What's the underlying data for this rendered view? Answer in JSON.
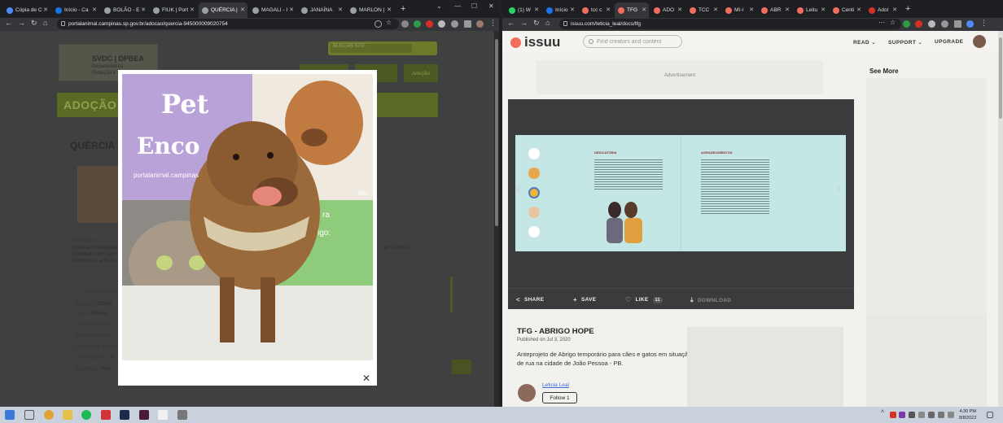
{
  "left_browser": {
    "tabs": [
      {
        "label": "Cópia de C",
        "color": "#4e8df5"
      },
      {
        "label": "Início - Ca",
        "color": "#1a73e8"
      },
      {
        "label": "BOLÃO - E",
        "color": "#9aa0a6"
      },
      {
        "label": "FIUK | Port",
        "color": "#9aa0a6"
      },
      {
        "label": "QUÉRCIA |",
        "color": "#9aa0a6"
      },
      {
        "label": "MAGALI - I",
        "color": "#9aa0a6"
      },
      {
        "label": "JANAÍNA",
        "color": "#9aa0a6"
      },
      {
        "label": "MARLON |",
        "color": "#9aa0a6"
      }
    ],
    "url": "portalanimal.campinas.sp.gov.br/adocao/quercia-945000009020754",
    "page": {
      "logo_text": "SVDC | DPBEA",
      "logo_sub_1": "Departamento",
      "logo_sub_2": "Proteção e",
      "search_placeholder": "BUSCAR SITE",
      "nav_3": "Adoção",
      "banner": "ADOÇÃO",
      "heading": "QUÉRCIA",
      "description_label": "Descrição:",
      "desc_line_1": "Quércia foi resgatada",
      "desc_line_2": "Perueiras tem sido",
      "desc_line_3": "O prazo do adoção",
      "desc_right": "ao DPBEA.",
      "characteristics": "• Características",
      "fields": [
        {
          "label": "Espécie:",
          "value": "Canin"
        },
        {
          "label": "Sexo:",
          "value": "Fêmea"
        },
        {
          "label": "Idade Estimada:",
          "value": ""
        },
        {
          "label": "Porte/Tamanho:",
          "value": ""
        },
        {
          "label": "Estado de Saúde:",
          "value": ""
        },
        {
          "label": "Vermifugado:",
          "value": "S"
        },
        {
          "label": "Castrado:",
          "value": "Não"
        }
      ]
    },
    "modal": {
      "photo_text_1": "Pet",
      "photo_text_2": "Enco",
      "photo_site": "portalanimal.campinas",
      "photo_side_1": "ra",
      "photo_side_2": "igo:",
      "photo_corner": "Mo"
    }
  },
  "right_browser": {
    "tabs": [
      {
        "label": "(1) W",
        "color": "#25d366"
      },
      {
        "label": "Início",
        "color": "#1a73e8"
      },
      {
        "label": "tcc c",
        "color": "#f36d5d"
      },
      {
        "label": "TFG",
        "color": "#f36d5d"
      },
      {
        "label": "ADO",
        "color": "#f36d5d"
      },
      {
        "label": "TCC",
        "color": "#f36d5d"
      },
      {
        "label": "MI-I",
        "color": "#f36d5d"
      },
      {
        "label": "ABR",
        "color": "#f36d5d"
      },
      {
        "label": "Leitu",
        "color": "#f36d5d"
      },
      {
        "label": "Centi",
        "color": "#f36d5d"
      },
      {
        "label": "Adol",
        "color": "#d93025"
      }
    ],
    "url": "issuu.com/leticia_leal/docs/tfg",
    "issuu": {
      "logo": "issuu",
      "search_placeholder": "Find creators and content",
      "nav_read": "READ ⌄",
      "nav_support": "SUPPORT ⌄",
      "nav_upgrade": "UPGRADE",
      "ad_label": "Advertisement",
      "see_more": "See More",
      "spread_left_title": "DEDICATÓRIA",
      "spread_right_title": "AGRADECIMENTOS",
      "actions": {
        "share": "SHARE",
        "save": "SAVE",
        "like": "LIKE",
        "like_count": "11",
        "download": "DOWNLOAD"
      },
      "doc_title": "TFG - ABRIGO HOPE",
      "published": "Published on Jul 3, 2020",
      "description": "Anteprojeto de Abrigo temporário para cães e gatos em situação de rua na cidade de João Pessoa - PB.",
      "author": "Leticia Leal",
      "follow": "Follow 1"
    }
  },
  "taskbar": {
    "time": "4:30 PM",
    "date": "8/8/2022"
  },
  "colors": {
    "issuu_brand": "#f36d5d",
    "adocao_green": "#596a24",
    "taskbar": "#c9d2dc"
  }
}
